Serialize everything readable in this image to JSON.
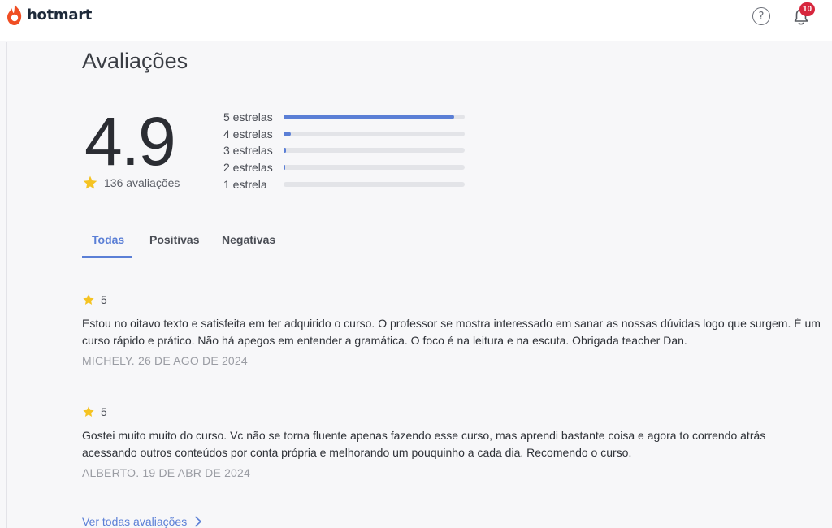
{
  "header": {
    "brand": "hotmart",
    "help_symbol": "?",
    "notification_count": "10",
    "colors": {
      "brand": "#f04e23",
      "badge": "#d7263d"
    },
    "icons": {
      "logo": "flame-icon",
      "help": "question-circle-icon",
      "notifications": "bell-icon"
    }
  },
  "reviews_section": {
    "title": "Avaliações",
    "average": "4.9",
    "total_label": "136 avaliações",
    "accent_color": "#5b7fd6",
    "distribution": [
      {
        "label": "5 estrelas",
        "fraction": 0.94
      },
      {
        "label": "4 estrelas",
        "fraction": 0.04
      },
      {
        "label": "3 estrelas",
        "fraction": 0.015
      },
      {
        "label": "2 estrelas",
        "fraction": 0.007
      },
      {
        "label": "1 estrela",
        "fraction": 0.0
      }
    ],
    "tabs": [
      {
        "label": "Todas",
        "active": true
      },
      {
        "label": "Positivas",
        "active": false
      },
      {
        "label": "Negativas",
        "active": false
      }
    ],
    "reviews": [
      {
        "rating": "5",
        "text": "Estou no oitavo texto e satisfeita em ter adquirido o curso. O professor se mostra interessado em sanar as nossas dúvidas logo que surgem. É um curso rápido e prático. Não há apegos em entender a gramática. O foco é na leitura e na escuta. Obrigada teacher Dan.",
        "meta": "MICHELY. 26 DE AGO DE 2024"
      },
      {
        "rating": "5",
        "text": "Gostei muito muito do curso. Vc não se torna fluente apenas fazendo esse curso, mas aprendi bastante coisa e agora to correndo atrás acessando outros conteúdos por conta própria e melhorando um pouquinho a cada dia. Recomendo o curso.",
        "meta": "ALBERTO. 19 DE ABR DE 2024"
      }
    ],
    "see_all_label": "Ver todas avaliações"
  }
}
